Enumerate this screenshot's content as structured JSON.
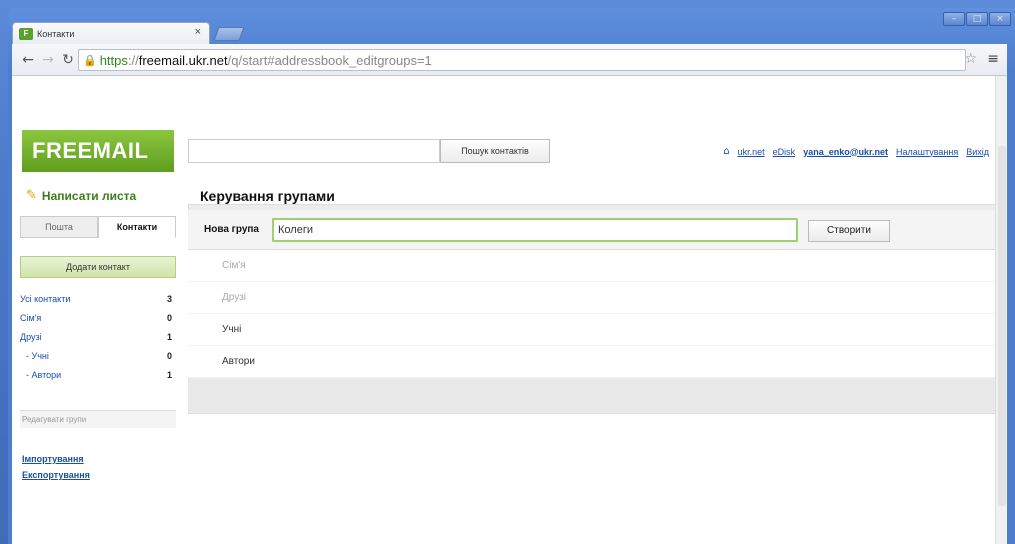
{
  "browser": {
    "tab_title": "Контакти",
    "tab_close": "×",
    "url_https": "https",
    "url_sep": "://",
    "url_host": "freemail.ukr.net",
    "url_path": "/q/start#addressbook_editgroups=1",
    "window_controls": [
      "–",
      "□",
      "×"
    ]
  },
  "header": {
    "logo": "FREEMAIL",
    "search_placeholder": "",
    "search_button": "Пошук контактів",
    "links": {
      "home": "ukr.net",
      "edisk": "eDisk",
      "user": "yana_enko@ukr.net",
      "settings": "Налаштування",
      "logout": "Вихід"
    }
  },
  "sidebar": {
    "compose": "Написати листа",
    "tabs": [
      "Пошта",
      "Контакти"
    ],
    "add_contact": "Додати контакт",
    "groups": [
      {
        "name": "Усі контакти",
        "count": "3",
        "sub": false
      },
      {
        "name": "Сім'я",
        "count": "0",
        "sub": false
      },
      {
        "name": "Друзі",
        "count": "1",
        "sub": false
      },
      {
        "name": "- Учні",
        "count": "0",
        "sub": true
      },
      {
        "name": "- Автори",
        "count": "1",
        "sub": true
      }
    ],
    "edit_groups": "Редагувати групи",
    "import": "Імпортування",
    "export": "Експортування"
  },
  "main": {
    "title": "Керування групами",
    "new_group_label": "Нова група",
    "new_group_value": "Колеги",
    "create_button": "Створити",
    "groups": [
      {
        "name": "Сім'я",
        "faded": true
      },
      {
        "name": "Друзі",
        "faded": true
      },
      {
        "name": "Учні",
        "faded": false
      },
      {
        "name": "Автори",
        "faded": false
      }
    ]
  }
}
